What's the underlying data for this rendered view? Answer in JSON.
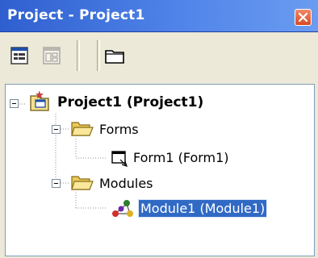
{
  "window": {
    "title": "Project - Project1"
  },
  "toolbar": {
    "buttons": [
      {
        "icon": "view-code-icon"
      },
      {
        "icon": "view-object-icon"
      },
      {
        "icon": "toggle-folders-icon"
      }
    ]
  },
  "tree": {
    "root": {
      "label": "Project1 (Project1)",
      "icon": "project-icon"
    },
    "groups": [
      {
        "label": "Forms",
        "icon": "folder-open-icon",
        "items": [
          {
            "label": "Form1 (Form1)",
            "icon": "form-icon",
            "selected": false
          }
        ]
      },
      {
        "label": "Modules",
        "icon": "folder-open-icon",
        "items": [
          {
            "label": "Module1 (Module1)",
            "icon": "module-icon",
            "selected": true
          }
        ]
      }
    ]
  },
  "colors": {
    "title_gradient_start": "#2f5fcf",
    "title_gradient_end": "#6a9cf0",
    "selection": "#316ac5",
    "window_bg": "#ece9d8",
    "close_button": "#d84a23"
  }
}
